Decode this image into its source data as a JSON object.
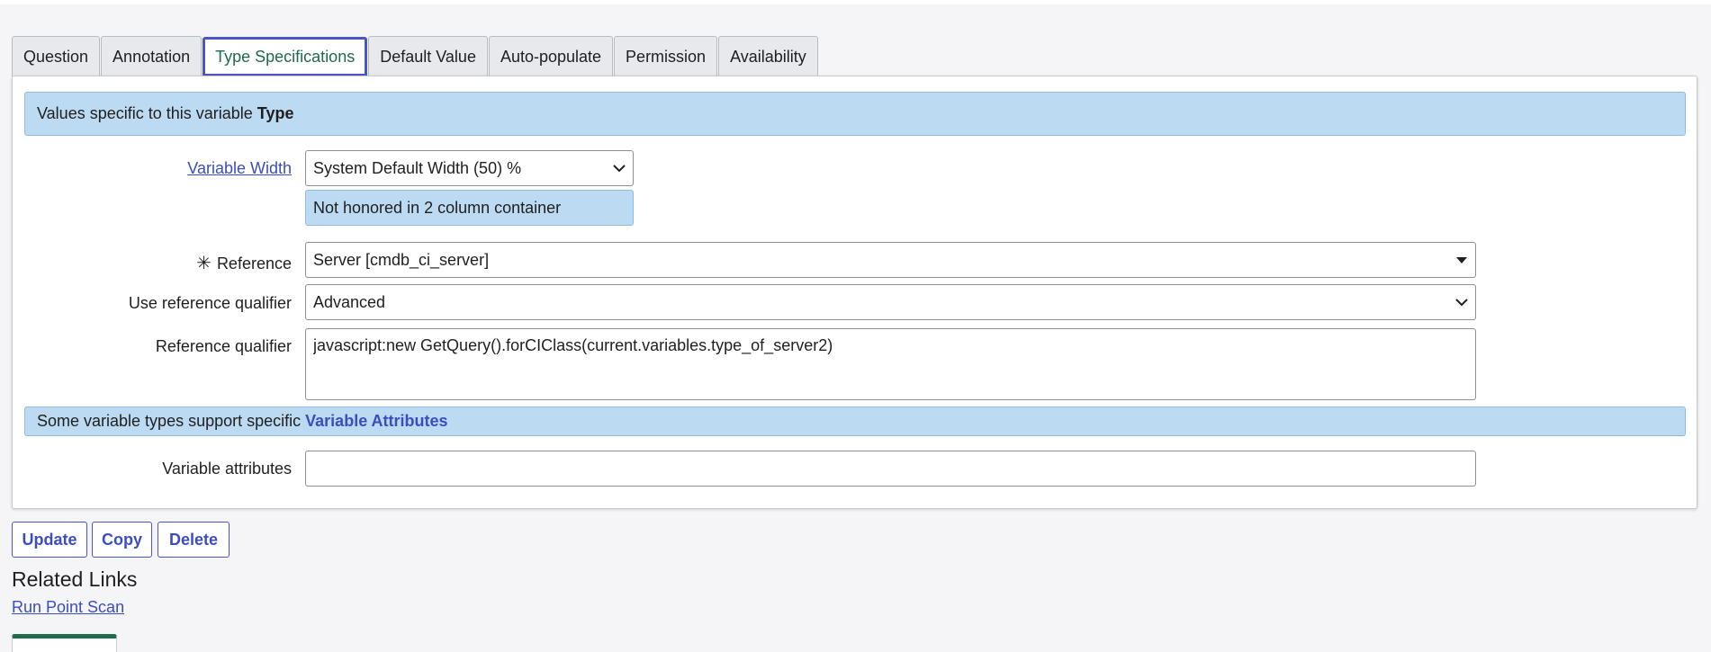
{
  "tabs": [
    {
      "label": "Question"
    },
    {
      "label": "Annotation"
    },
    {
      "label": "Type Specifications"
    },
    {
      "label": "Default Value"
    },
    {
      "label": "Auto-populate"
    },
    {
      "label": "Permission"
    },
    {
      "label": "Availability"
    }
  ],
  "active_tab": "Type Specifications",
  "type_banner": {
    "text": "Values specific to this variable",
    "bold": "Type"
  },
  "variable_width": {
    "label": "Variable Width",
    "value": "System Default Width (50) %",
    "note": "Not honored in 2 column container"
  },
  "reference": {
    "label": "Reference",
    "value": "Server [cmdb_ci_server]",
    "required": true
  },
  "use_reference_qualifier": {
    "label": "Use reference qualifier",
    "value": "Advanced"
  },
  "reference_qualifier": {
    "label": "Reference qualifier",
    "value": "javascript:new GetQuery().forCIClass(current.variables.type_of_server2)"
  },
  "attributes_banner": {
    "text": "Some variable types support specific",
    "link": "Variable Attributes"
  },
  "variable_attributes": {
    "label": "Variable attributes",
    "value": ""
  },
  "buttons": {
    "update": "Update",
    "copy": "Copy",
    "delete": "Delete"
  },
  "related_links": {
    "title": "Related Links",
    "items": [
      "Run Point Scan"
    ]
  },
  "colors": {
    "accent": "#3b4dbf",
    "active_tab_text": "#1f6b4a",
    "banner_bg": "#bcdaf1",
    "page_bg": "#f5f5f7"
  },
  "icons": {
    "required": "asterisk-icon",
    "select": "chevron-down-icon",
    "reference": "caret-down-icon"
  }
}
